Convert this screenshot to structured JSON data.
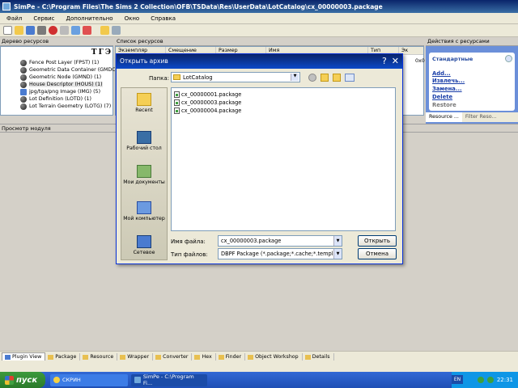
{
  "window": {
    "title": "SimPe - C:\\Program Files\\The Sims 2 Collection\\OFB\\TSData\\Res\\UserData\\LotCatalog\\cx_00000003.package"
  },
  "menu": [
    "Файл",
    "Сервис",
    "Дополнительно",
    "Окно",
    "Справка"
  ],
  "panels": {
    "tree_title": "Дерево ресурсов",
    "list_title": "Список ресурсов",
    "actions_title": "Действия с ресурсами",
    "preview_title": "Просмотр модуля"
  },
  "tree": {
    "toolbar": [
      "T",
      "Г",
      "Э"
    ],
    "items": [
      {
        "label": "Fence Post Layer (FPST) (1)"
      },
      {
        "label": "Geometric Data Container (GMDC)"
      },
      {
        "label": "Geometric Node (GMND) (1)"
      },
      {
        "label": "House Descriptor (HOUS) (1)"
      },
      {
        "label": "jpg/tga/png Image (IMG) (5)"
      },
      {
        "label": "Lot Definition (LOTD) (1)"
      },
      {
        "label": "Lot Terrain Geometry (LOTG) (7)"
      }
    ]
  },
  "reslist": {
    "columns": [
      "Экземпляр",
      "Смещение",
      "Размер",
      "Имя",
      "Тип",
      "Эк"
    ],
    "partial_value": "0x0"
  },
  "actions": {
    "group": "Стандартные",
    "items": [
      "Add...",
      "Извлечь...",
      "Замена...",
      "Delete",
      "Restore"
    ],
    "tabs": [
      "Resource ...",
      "Filter Reso..."
    ]
  },
  "bottom_tabs": [
    "Plugin View",
    "Package",
    "Resource",
    "Wrapper",
    "Converter",
    "Hex",
    "Finder",
    "Object Workshop",
    "Details"
  ],
  "taskbar": {
    "start": "пуск",
    "tasks": [
      "СКРИН",
      "SimPe - C:\\Program Fi..."
    ],
    "lang": "EN",
    "time": "22:31"
  },
  "dialog": {
    "title": "Открыть архив",
    "folder_label": "Папка:",
    "folder_value": "LotCatalog",
    "places": [
      "Recent",
      "Рабочий стол",
      "Мои документы",
      "Мой компьютер",
      "Сетевое"
    ],
    "files": [
      "cx_00000001.package",
      "cx_00000003.package",
      "cx_00000004.package"
    ],
    "filename_label": "Имя файла:",
    "filename_value": "cx_00000003.package",
    "filetype_label": "Тип файлов:",
    "filetype_value": "DBPF Package (*.package;*.cache;*.template;",
    "open_button": "Открыть",
    "cancel_button": "Отмена"
  }
}
